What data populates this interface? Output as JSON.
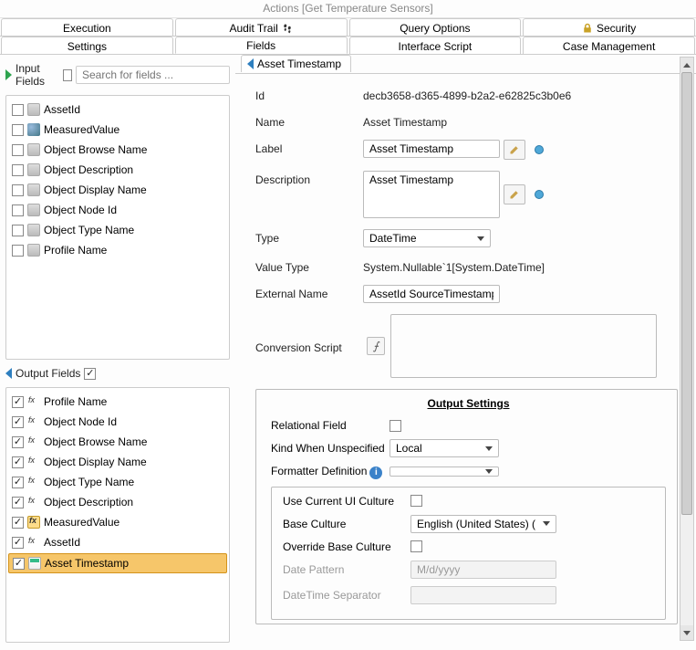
{
  "title": "Actions [Get Temperature Sensors]",
  "tabs_row1": [
    {
      "label": "Execution"
    },
    {
      "label": "Audit Trail",
      "icon": "footprint"
    },
    {
      "label": "Query Options"
    },
    {
      "label": "Security",
      "icon": "lock"
    }
  ],
  "tabs_row2": [
    {
      "label": "Settings"
    },
    {
      "label": "Fields",
      "active": true
    },
    {
      "label": "Interface Script"
    },
    {
      "label": "Case Management"
    }
  ],
  "left": {
    "input_header": "Input Fields",
    "input_checked": false,
    "search_placeholder": "Search for fields ...",
    "output_header": "Output Fields",
    "output_checked": true,
    "inputs": [
      {
        "label": "AssetId"
      },
      {
        "label": "MeasuredValue",
        "icon": "gauge"
      },
      {
        "label": "Object Browse Name"
      },
      {
        "label": "Object Description"
      },
      {
        "label": "Object Display Name"
      },
      {
        "label": "Object Node Id"
      },
      {
        "label": "Object Type Name"
      },
      {
        "label": "Profile Name"
      }
    ],
    "outputs": [
      {
        "label": "Profile Name"
      },
      {
        "label": "Object Node Id"
      },
      {
        "label": "Object Browse Name"
      },
      {
        "label": "Object Display Name"
      },
      {
        "label": "Object Type Name"
      },
      {
        "label": "Object Description"
      },
      {
        "label": "MeasuredValue",
        "icon": "fxb"
      },
      {
        "label": "AssetId"
      },
      {
        "label": "Asset Timestamp",
        "icon": "ts",
        "selected": true
      }
    ]
  },
  "detail": {
    "tab_label": "Asset Timestamp",
    "id_label": "Id",
    "id_value": "decb3658-d365-4899-b2a2-e62825c3b0e6",
    "name_label": "Name",
    "name_value": "Asset Timestamp",
    "label_label": "Label",
    "label_value": "Asset Timestamp",
    "desc_label": "Description",
    "desc_value": "Asset Timestamp",
    "type_label": "Type",
    "type_value": "DateTime",
    "vtype_label": "Value Type",
    "vtype_value": "System.Nullable`1[System.DateTime]",
    "extname_label": "External Name",
    "extname_value": "AssetId SourceTimestamp",
    "conv_label": "Conversion Script"
  },
  "settings": {
    "heading": "Output Settings",
    "relational_label": "Relational Field",
    "relational_checked": false,
    "kind_label": "Kind When Unspecified",
    "kind_value": "Local",
    "formatter_label": "Formatter Definition",
    "formatter_value": "",
    "culture": {
      "useui_label": "Use Current UI Culture",
      "useui_checked": false,
      "base_label": "Base Culture",
      "base_value": "English (United States)  (",
      "override_label": "Override Base Culture",
      "override_checked": false,
      "datepat_label": "Date Pattern",
      "datepat_value": "M/d/yyyy",
      "dtsep_label": "DateTime Separator",
      "dtsep_value": ""
    }
  }
}
